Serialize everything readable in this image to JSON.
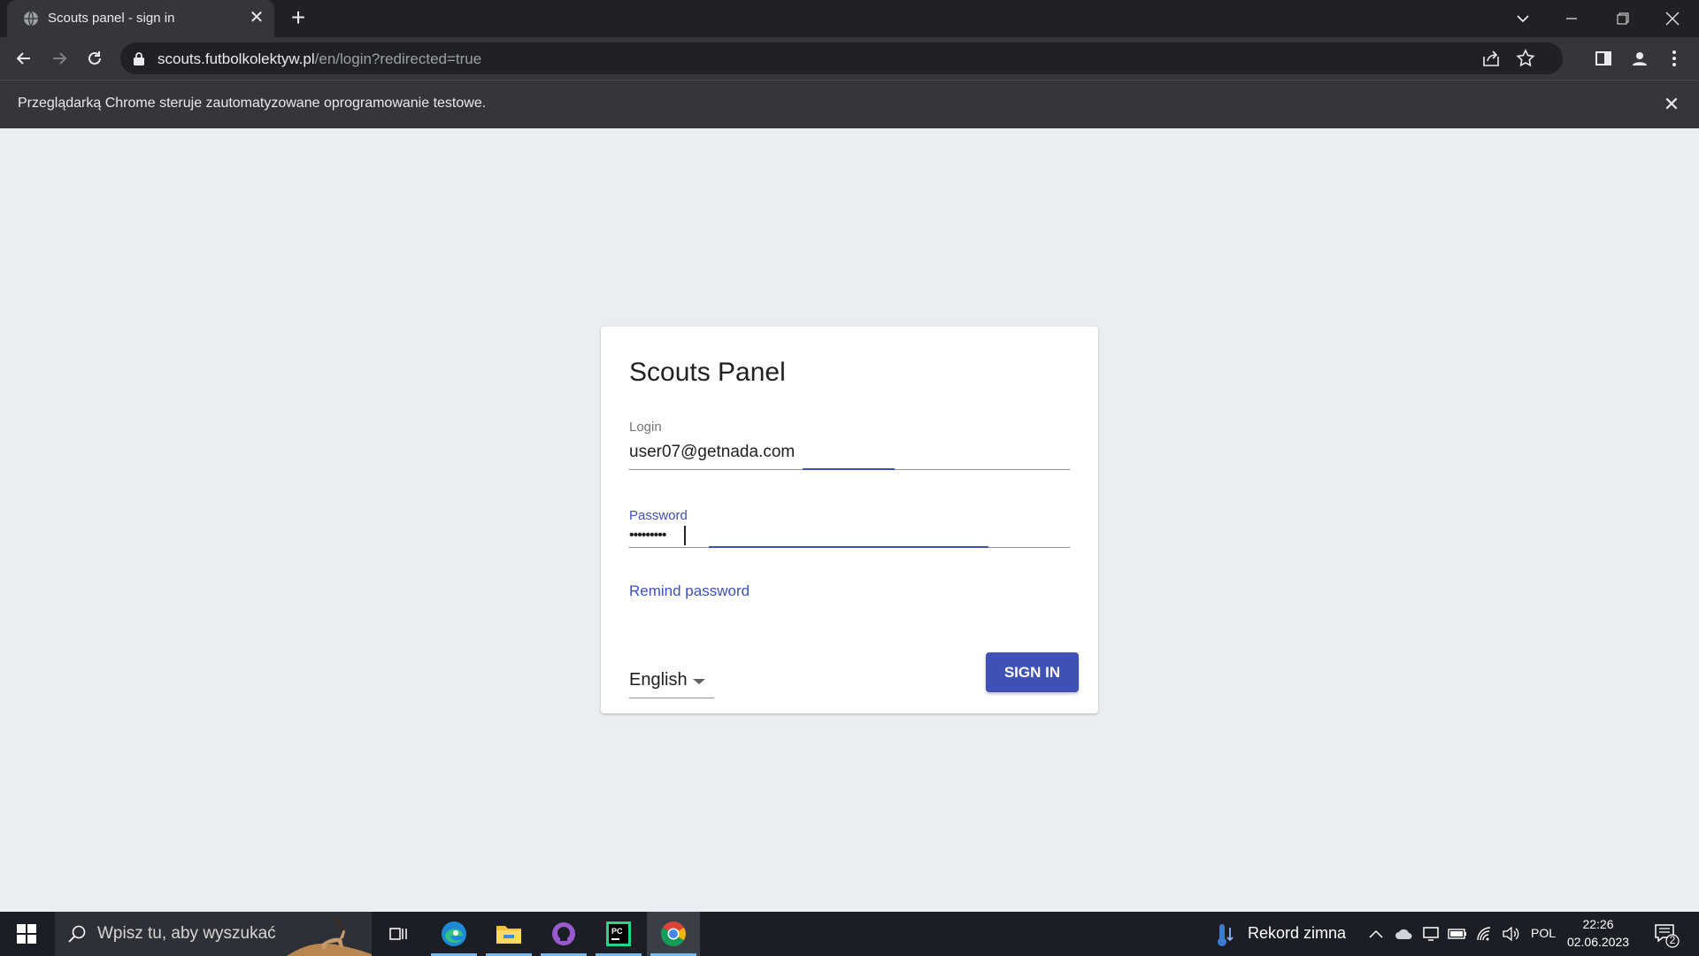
{
  "browser": {
    "tab": {
      "title": "Scouts panel - sign in"
    },
    "url": {
      "host": "scouts.futbolkolektyw.pl",
      "path": "/en/login?redirected=true"
    },
    "infobar": {
      "message": "Przeglądarką Chrome steruje zautomatyzowane oprogramowanie testowe."
    }
  },
  "login_card": {
    "heading": "Scouts Panel",
    "login": {
      "label": "Login",
      "value": "user07@getnada.com"
    },
    "password": {
      "label": "Password",
      "masked_value": "•••••••••"
    },
    "remind_link": "Remind password",
    "language": {
      "selected": "English"
    },
    "sign_in_label": "SIGN IN",
    "accent_color": "#3f51b5"
  },
  "taskbar": {
    "search_placeholder": "Wpisz tu, aby wyszukać",
    "weather_text": "Rekord zimna",
    "language": "POL",
    "time": "22:26",
    "date": "02.06.2023",
    "notification_count": "2",
    "apps": [
      "task-view",
      "edge",
      "file-explorer",
      "github-desktop",
      "pycharm",
      "chrome"
    ]
  }
}
